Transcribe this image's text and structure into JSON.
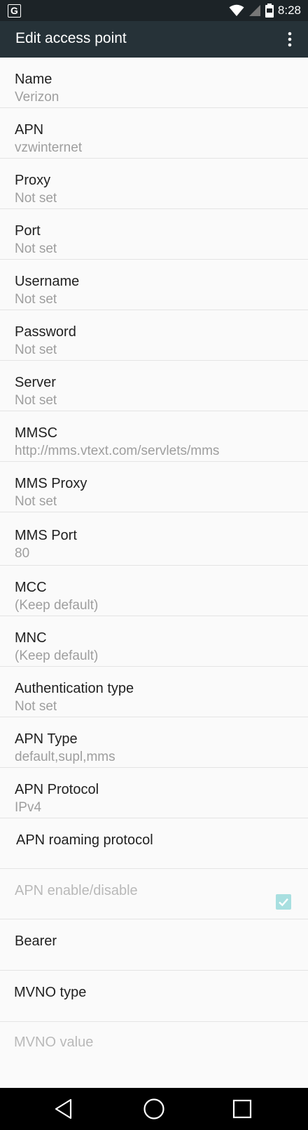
{
  "status_bar": {
    "time": "8:28",
    "app_letter": "G"
  },
  "app_bar": {
    "title": "Edit access point"
  },
  "colors": {
    "app_bar": "#263238",
    "status_bar": "#1c2327",
    "checkbox_disabled": "#a8dfe0"
  },
  "items": [
    {
      "title": "Name",
      "summary": "Verizon"
    },
    {
      "title": "APN",
      "summary": "vzwinternet"
    },
    {
      "title": "Proxy",
      "summary": "Not set"
    },
    {
      "title": "Port",
      "summary": "Not set"
    },
    {
      "title": "Username",
      "summary": "Not set"
    },
    {
      "title": "Password",
      "summary": "Not set"
    },
    {
      "title": "Server",
      "summary": "Not set"
    },
    {
      "title": "MMSC",
      "summary": "http://mms.vtext.com/servlets/mms"
    },
    {
      "title": "MMS Proxy",
      "summary": "Not set"
    },
    {
      "title": "MMS Port",
      "summary": "80"
    },
    {
      "title": "MCC",
      "summary": "(Keep default)"
    },
    {
      "title": "MNC",
      "summary": "(Keep default)"
    },
    {
      "title": "Authentication  type",
      "summary": "Not set"
    },
    {
      "title": "APN Type",
      "summary": "default,supl,mms"
    },
    {
      "title": "APN Protocol",
      "summary": "IPv4"
    },
    {
      "title": "APN roaming protocol",
      "summary": ""
    },
    {
      "title": "APN enable/disable",
      "summary": "",
      "checked": true,
      "enabled": false
    },
    {
      "title": "Bearer",
      "summary": ""
    },
    {
      "title": "MVNO type",
      "summary": ""
    },
    {
      "title": "MVNO value",
      "summary": "",
      "enabled": false
    }
  ]
}
